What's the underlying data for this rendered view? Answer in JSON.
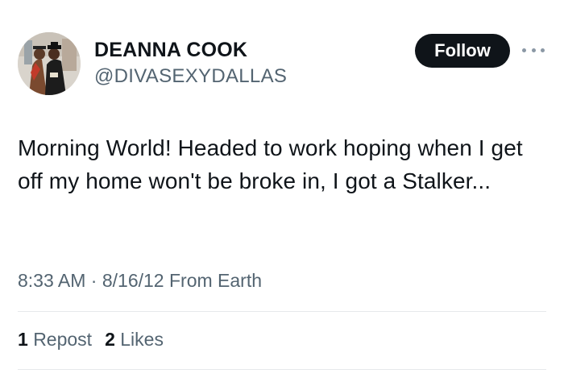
{
  "author": {
    "display_name": "DEANNA COOK",
    "handle": "@DIVASEXYDALLAS",
    "avatar_icon": "profile-photo"
  },
  "actions": {
    "follow_label": "Follow",
    "more_icon": "more-horizontal-icon"
  },
  "tweet": {
    "text": "Morning World! Headed to work hoping when I get off my home won't be broke in, I got a Stalker...",
    "time": "8:33 AM",
    "separator": "·",
    "date": "8/16/12",
    "source": "From Earth"
  },
  "stats": {
    "reposts_count": "1",
    "reposts_label": "Repost",
    "likes_count": "2",
    "likes_label": "Likes"
  },
  "colors": {
    "text_primary": "#0f1419",
    "text_secondary": "#536471",
    "button_bg": "#0f1419",
    "divider": "#e6e9eb"
  }
}
